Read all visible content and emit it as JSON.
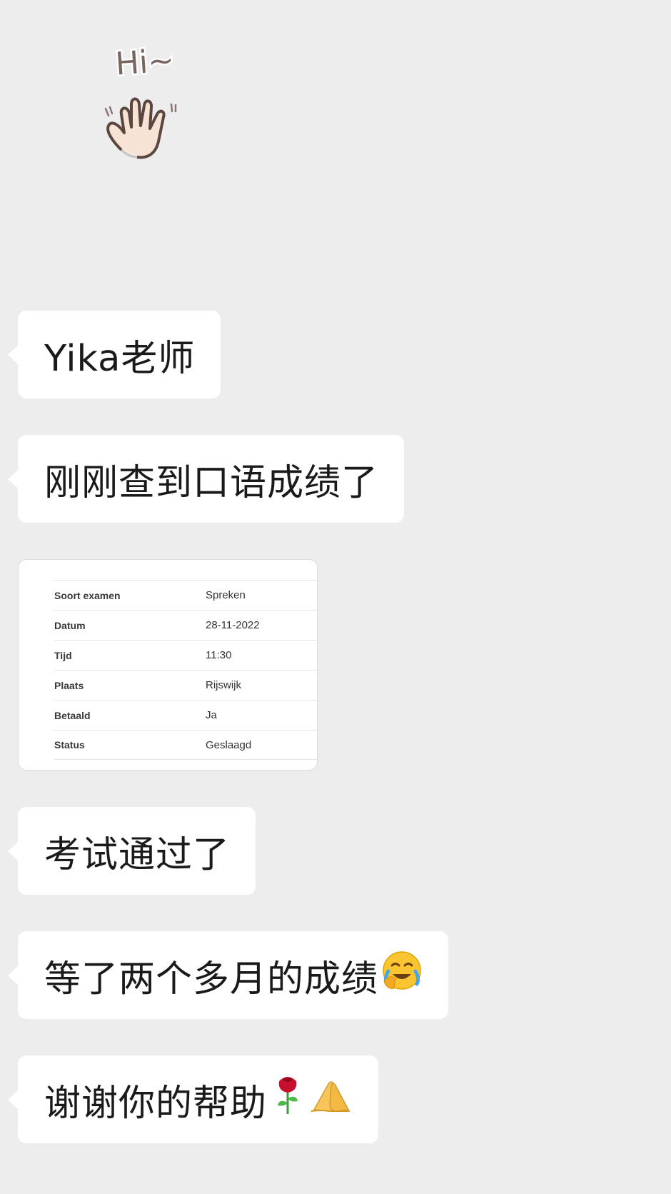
{
  "messages": {
    "greeting_sticker_text": "Hi~",
    "msg_1": "Yika老师",
    "msg_2": "刚刚查到口语成绩了",
    "exam_card": {
      "rows": [
        {
          "label": "Soort examen",
          "value": "Spreken"
        },
        {
          "label": "Datum",
          "value": "28-11-2022"
        },
        {
          "label": "Tijd",
          "value": "11:30"
        },
        {
          "label": "Plaats",
          "value": "Rijswijk"
        },
        {
          "label": "Betaald",
          "value": "Ja"
        },
        {
          "label": "Status",
          "value": "Geslaagd"
        }
      ]
    },
    "msg_3": "考试通过了",
    "msg_4": "等了两个多月的成绩",
    "msg_5": "谢谢你的帮助"
  },
  "icons": {
    "sticker": "waving-hand-sticker",
    "msg_4_emoji": "face-exhaling-laugh-cry-icon",
    "msg_5_emoji_1": "rose-icon",
    "msg_5_emoji_2": "folded-hands-icon"
  },
  "colors": {
    "background": "#ededed",
    "bubble": "#ffffff",
    "text": "#1a1a1a"
  }
}
